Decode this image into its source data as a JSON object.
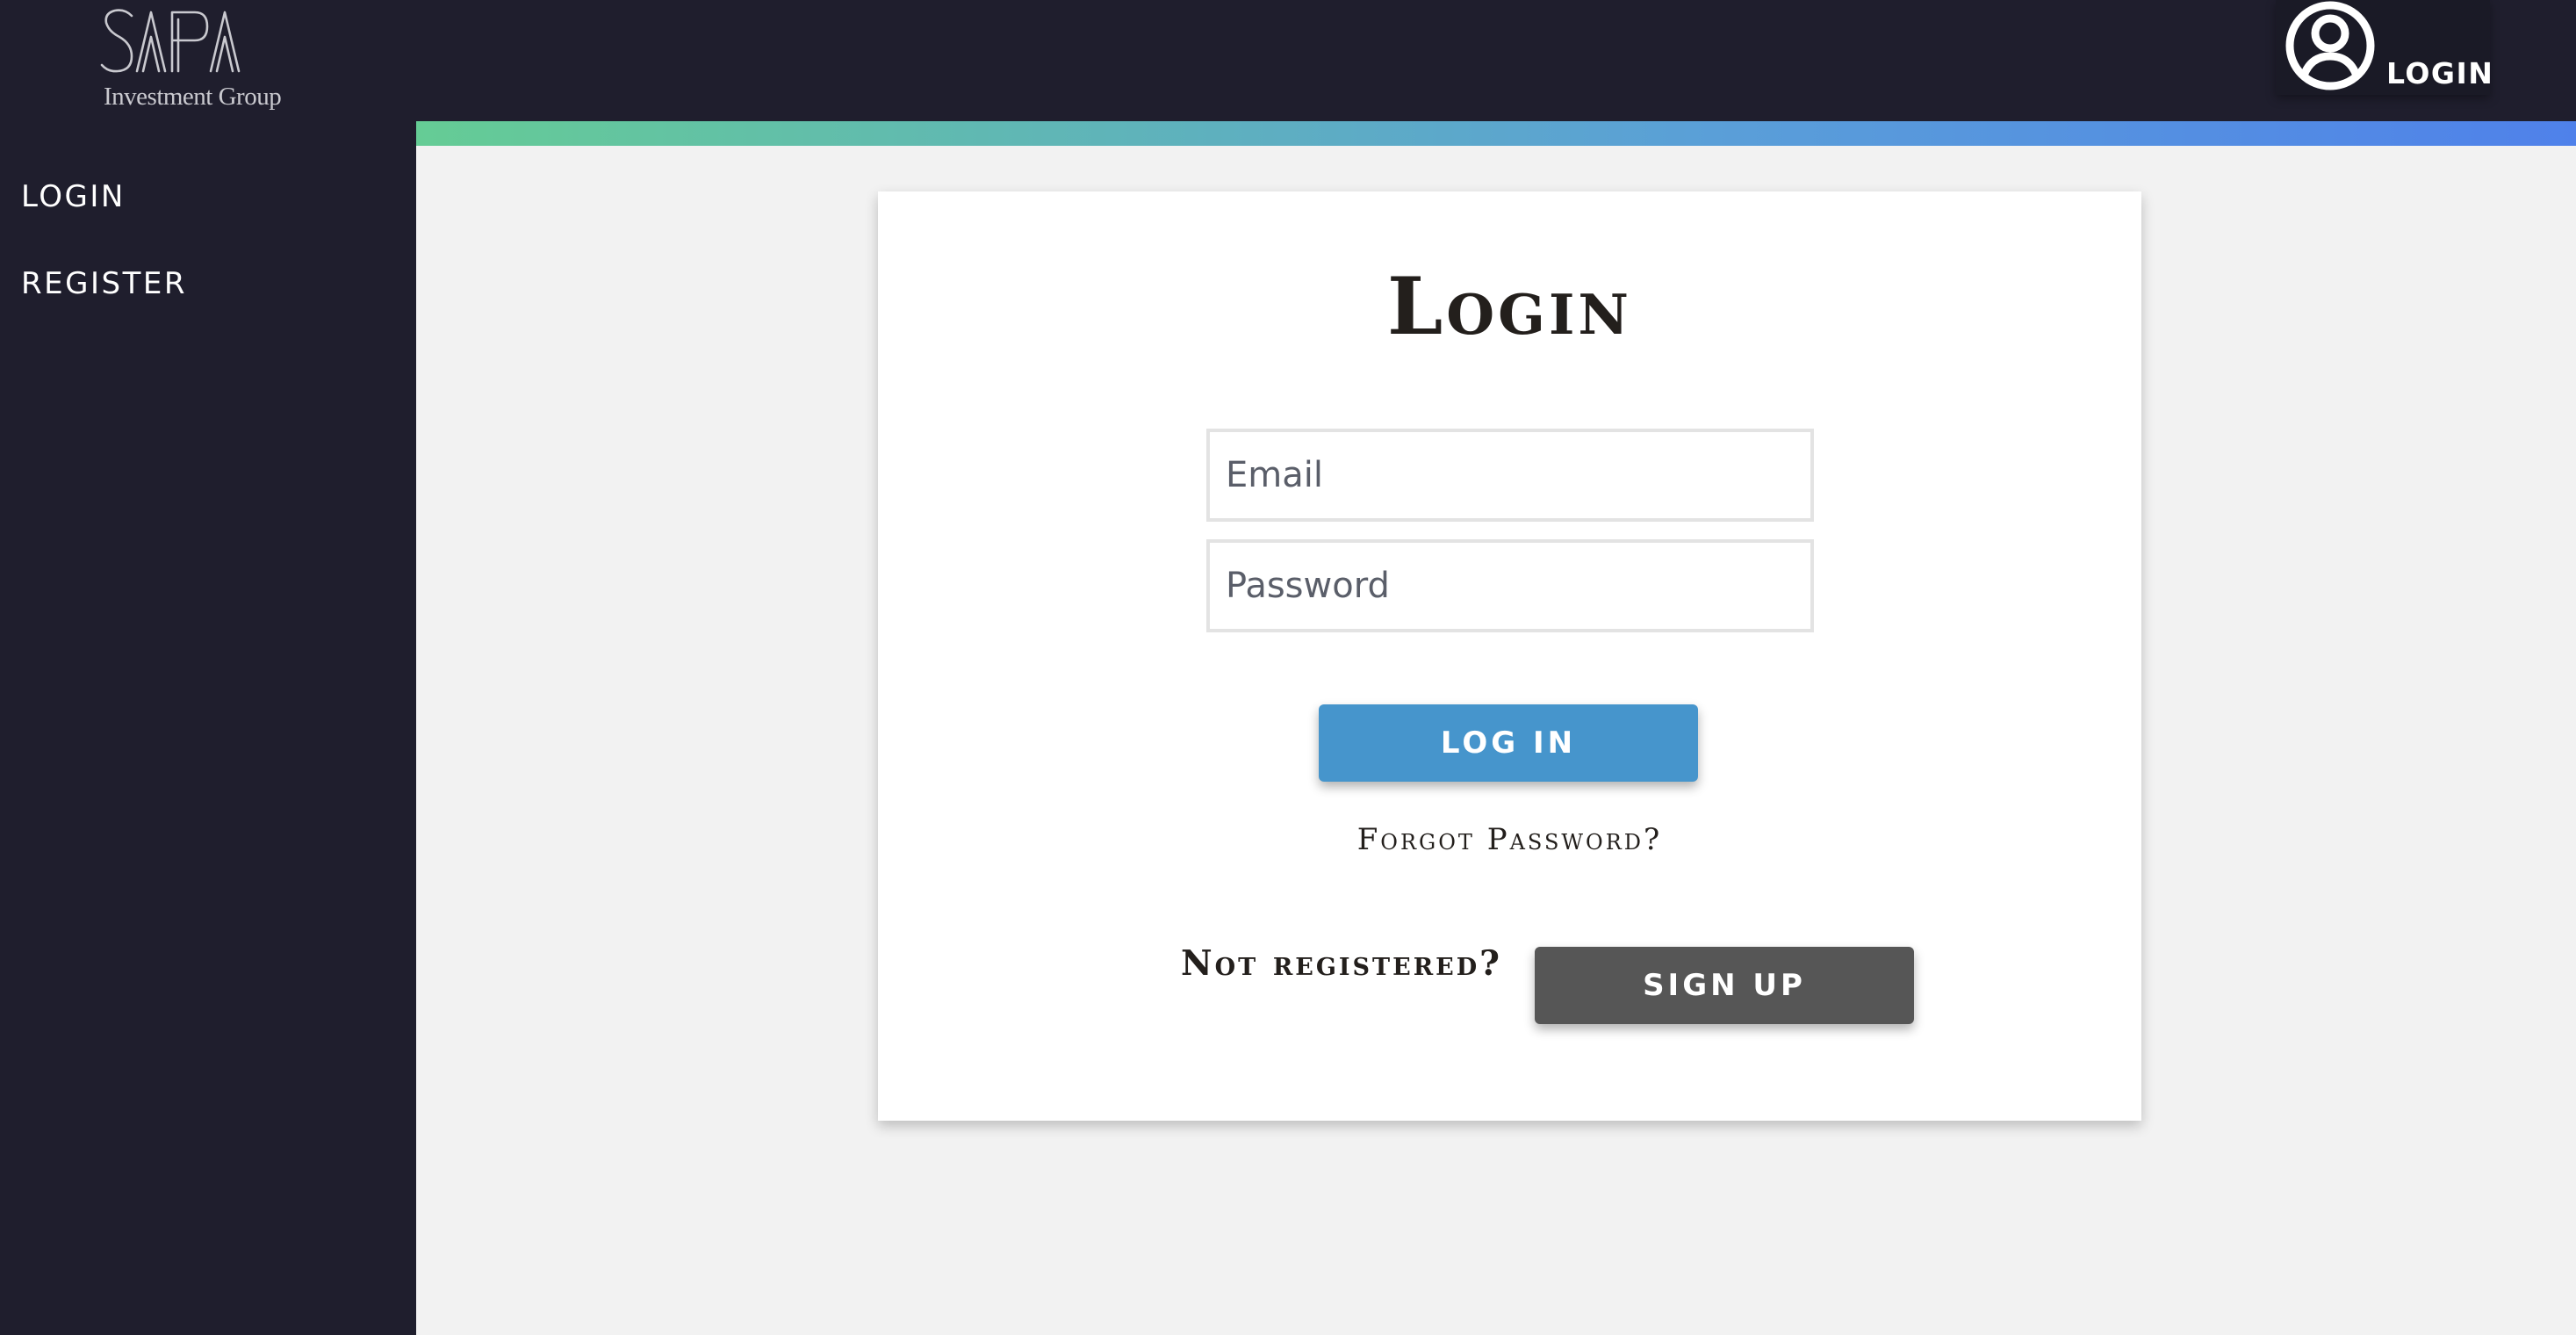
{
  "header": {
    "logo": {
      "wordmark": "SAPA",
      "subtitle": "Investment Group"
    },
    "account": {
      "icon": "user-circle-icon",
      "label": "LOGIN"
    }
  },
  "sidebar": {
    "items": [
      {
        "label": "LOGIN"
      },
      {
        "label": "REGISTER"
      }
    ]
  },
  "colors": {
    "nav_background": "#1f1e2d",
    "page_background": "#f2f2f2",
    "accent_gradient_start": "#65cc95",
    "accent_gradient_end": "#4f81ea",
    "login_button": "#4695cc",
    "signup_button": "#565656"
  },
  "login_card": {
    "title": "Login",
    "email": {
      "value": "",
      "placeholder": "Email"
    },
    "password": {
      "value": "",
      "placeholder": "Password"
    },
    "login_button": "LOG IN",
    "forgot_password": "Forgot Password?",
    "not_registered": "Not registered?",
    "signup_button": "SIGN UP"
  }
}
